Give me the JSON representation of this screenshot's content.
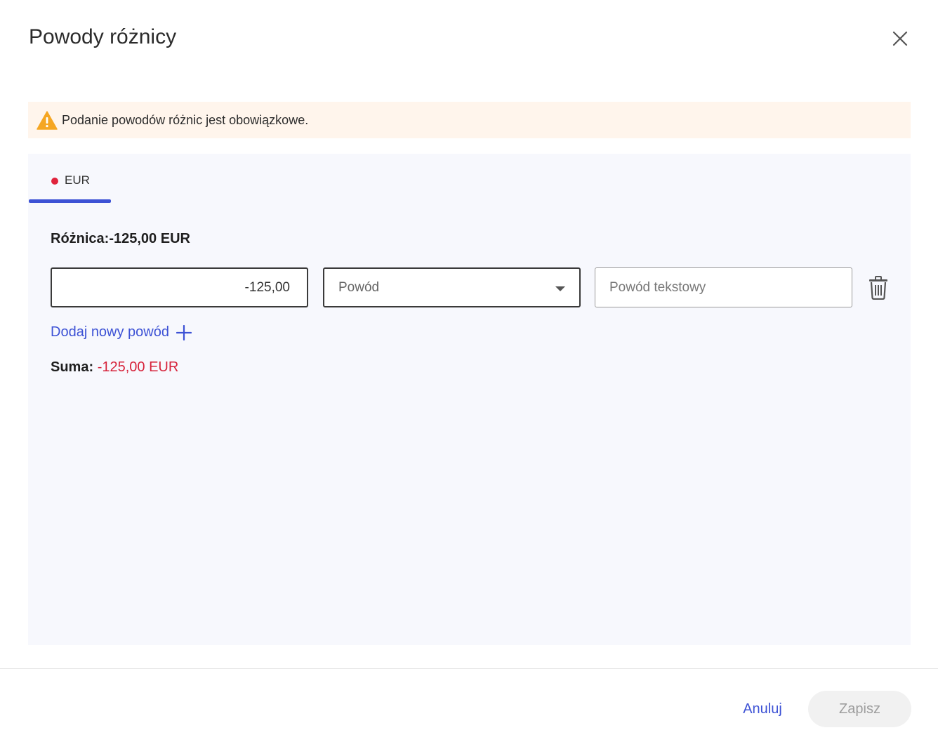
{
  "dialog": {
    "title": "Powody różnicy"
  },
  "warning": {
    "text": "Podanie powodów różnic jest obowiązkowe.",
    "color": "#f5a623"
  },
  "tabs": [
    {
      "label": "EUR",
      "status_color": "#e0233c",
      "active": true
    }
  ],
  "difference": {
    "label": "Różnica:-125,00 EUR"
  },
  "reason_row": {
    "amount": "-125,00",
    "reason_placeholder": "Powód",
    "text_placeholder": "Powód tekstowy"
  },
  "add_reason": {
    "label": "Dodaj nowy powód"
  },
  "sum": {
    "label": "Suma:",
    "value": "-125,00 EUR"
  },
  "footer": {
    "cancel_label": "Anuluj",
    "save_label": "Zapisz"
  },
  "colors": {
    "accent": "#3d52d5",
    "negative": "#d6223a",
    "panel_bg": "#f7f8fd",
    "warning_bg": "#fff5ec"
  }
}
